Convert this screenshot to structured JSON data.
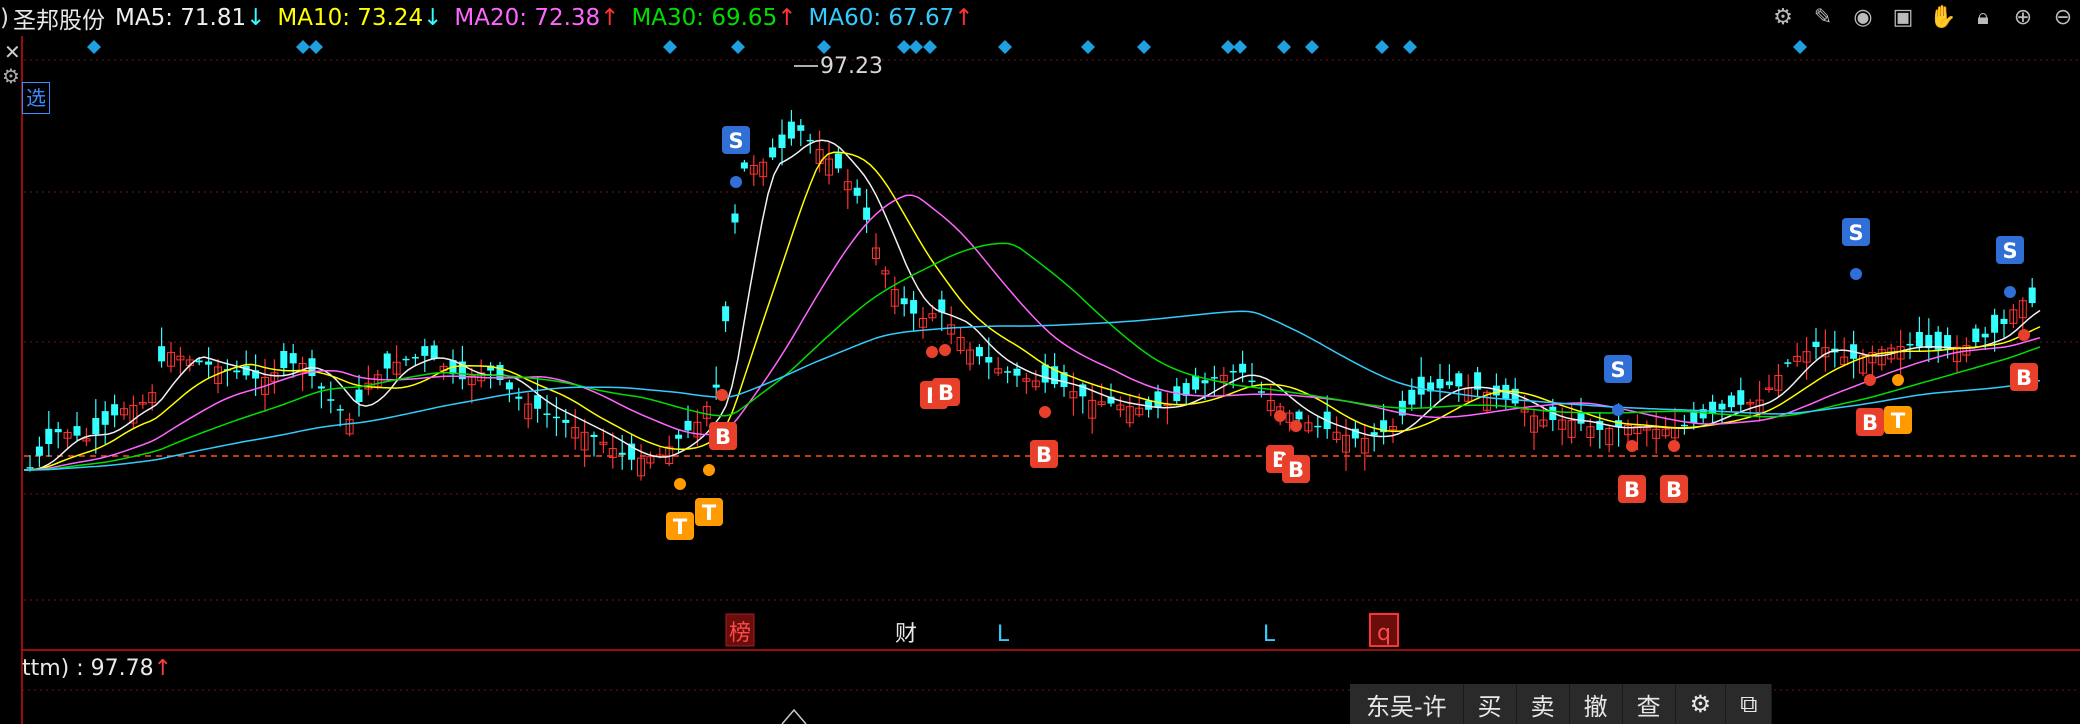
{
  "header": {
    "partial_prefix": ")",
    "stock_name": "圣邦股份",
    "ma5": {
      "label": "MA5: 71.81",
      "arrow": "↓",
      "color": "#f0f0f0"
    },
    "ma10": {
      "label": "MA10: 73.24",
      "arrow": "↓",
      "color": "#ffff00"
    },
    "ma20": {
      "label": "MA20: 72.38",
      "arrow": "↑",
      "color": "#ff66ff"
    },
    "ma30": {
      "label": "MA30: 69.65",
      "arrow": "↑",
      "color": "#00dd00"
    },
    "ma60": {
      "label": "MA60: 67.67",
      "arrow": "↑",
      "color": "#33ccff"
    }
  },
  "toolbar_icons": [
    "settings-icon",
    "pen-icon",
    "eye-icon",
    "briefcase-icon",
    "hand-icon",
    "lock-icon",
    "zoom-in-icon",
    "zoom-out-icon"
  ],
  "left_panel": {
    "select_label": "选"
  },
  "chart": {
    "high_annotation": "97.23",
    "event_markers": [
      {
        "label": "榜",
        "type": "box"
      },
      {
        "label": "财",
        "type": "plain"
      },
      {
        "label": "L",
        "type": "cyan"
      },
      {
        "label": "L",
        "type": "cyan"
      },
      {
        "label": "q",
        "type": "box"
      }
    ]
  },
  "pe": {
    "label": "ttm) : 97.78",
    "arrow": "↑"
  },
  "trade_bar": {
    "broker": "东吴-许",
    "buy": "买",
    "sell": "卖",
    "cancel": "撤",
    "query": "查"
  },
  "colors": {
    "up": "#ff3333",
    "down": "#33ffff",
    "ma5": "#f0f0f0",
    "ma10": "#ffff00",
    "ma20": "#ff66ff",
    "ma30": "#00dd00",
    "ma60": "#33ccff",
    "b_signal": "#e8402a",
    "s_signal": "#2f6fd6",
    "t_signal": "#ff9a00",
    "diamond": "#1fa0e0"
  }
}
